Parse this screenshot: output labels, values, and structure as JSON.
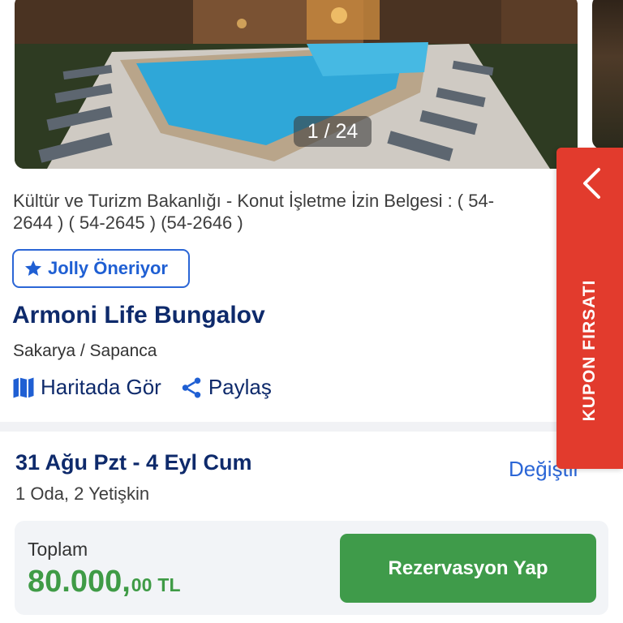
{
  "gallery": {
    "counter": "1 / 24"
  },
  "listing": {
    "license_line1": "Kültür ve Turizm Bakanlığı - Konut İşletme İzin Belgesi : ( 54-",
    "license_line2": "2644 ) ( 54-2645 ) (54-2646 )",
    "badge": "Jolly Öneriyor",
    "title": "Armoni Life Bungalov",
    "location": "Sakarya / Sapanca",
    "map_link": "Haritada Gör",
    "share_link": "Paylaş"
  },
  "booking": {
    "dates": "31 Ağu Pzt - 4 Eyl Cum",
    "change": "Değiştir",
    "guests": "1 Oda, 2 Yetişkin",
    "total_label": "Toplam",
    "price_main": "80.000,",
    "price_decimals": "00",
    "currency": "TL",
    "reserve_button": "Rezervasyon Yap"
  },
  "coupon": {
    "label": "KUPON FIRSATI"
  },
  "colors": {
    "brand_blue": "#0e2a6b",
    "link_blue": "#2b66d6",
    "price_green": "#3f9b46",
    "coupon_red": "#e23b2d"
  }
}
